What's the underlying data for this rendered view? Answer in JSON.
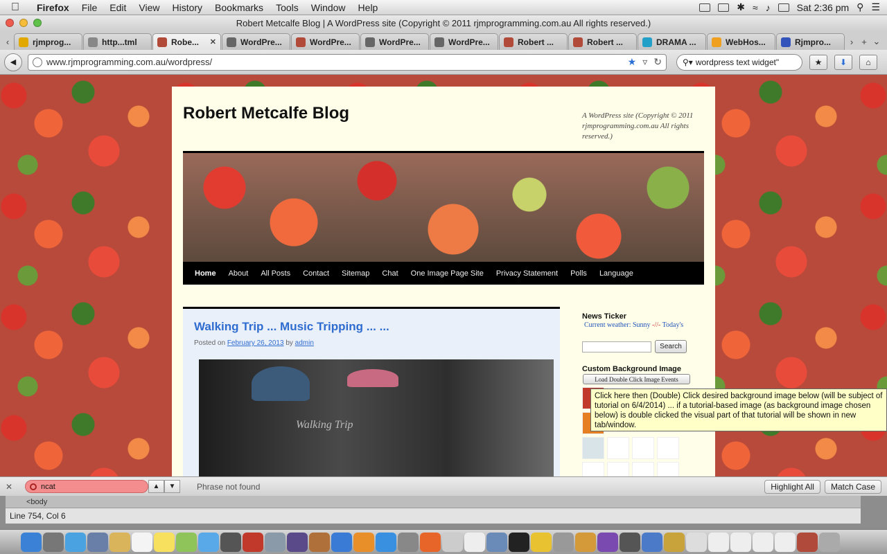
{
  "menubar": {
    "app": "Firefox",
    "items": [
      "File",
      "Edit",
      "View",
      "History",
      "Bookmarks",
      "Tools",
      "Window",
      "Help"
    ],
    "clock": "Sat 2:36 pm"
  },
  "window": {
    "title": "Robert Metcalfe Blog | A WordPress site (Copyright © 2011 rjmprogramming.com.au All rights reserved.)"
  },
  "tabs": [
    {
      "label": "rjmprog...",
      "icon": "check-icon",
      "color": "#e0a800"
    },
    {
      "label": "http...tml",
      "icon": "globe-icon",
      "color": "#888888"
    },
    {
      "label": "Robe...",
      "icon": "flower-icon",
      "color": "#b24a3a",
      "active": true
    },
    {
      "label": "WordPre...",
      "icon": "wordpress-icon",
      "color": "#666666"
    },
    {
      "label": "WordPre...",
      "icon": "flower-icon",
      "color": "#b24a3a"
    },
    {
      "label": "WordPre...",
      "icon": "wordpress-icon",
      "color": "#666666"
    },
    {
      "label": "WordPre...",
      "icon": "wordpress-icon",
      "color": "#666666"
    },
    {
      "label": "Robert ...",
      "icon": "flower-icon",
      "color": "#b24a3a"
    },
    {
      "label": "Robert ...",
      "icon": "flower-icon",
      "color": "#b24a3a"
    },
    {
      "label": "DRAMA ...",
      "icon": "play-icon",
      "color": "#22a0c8"
    },
    {
      "label": "WebHos...",
      "icon": "webhost-icon",
      "color": "#f0a020"
    },
    {
      "label": "Rjmpro...",
      "icon": "rjm-icon",
      "color": "#3355bb"
    }
  ],
  "nav": {
    "url": "www.rjmprogramming.com.au/wordpress/",
    "search": "wordpress text widget\""
  },
  "site": {
    "title": "Robert Metcalfe Blog",
    "description": "A WordPress site (Copyright © 2011 rjmprogramming.com.au All rights reserved.)",
    "menu": [
      "Home",
      "About",
      "All Posts",
      "Contact",
      "Sitemap",
      "Chat",
      "One Image Page Site",
      "Privacy Statement",
      "Polls",
      "Language"
    ],
    "post": {
      "title": "Walking Trip ... Music Tripping ... ...",
      "posted_on": "Posted on",
      "date": "February 26, 2013",
      "by": "by",
      "author": "admin",
      "image_caption": "Walking Trip"
    },
    "sidebar": {
      "ticker_title": "News Ticker",
      "ticker_a": "Current weather: Sunny",
      "ticker_sep": "-//-",
      "ticker_b": "Today's",
      "search_button": "Search",
      "bg_title": "Custom Background Image",
      "load_button": "Load Double Click Image Events"
    }
  },
  "tooltip": "Click here then (Double) Click desired background image below (will be subject of tutorial on 6/4/2014) ... if a tutorial-based image (as background image chosen below) is double clicked the visual part of that tutorial will be shown in new tab/window.",
  "findbar": {
    "value": "ncat",
    "status": "Phrase not found",
    "highlight": "Highlight All",
    "match_case": "Match Case"
  },
  "editor": {
    "find_text": "<body",
    "status": "Line 754, Col 6"
  }
}
